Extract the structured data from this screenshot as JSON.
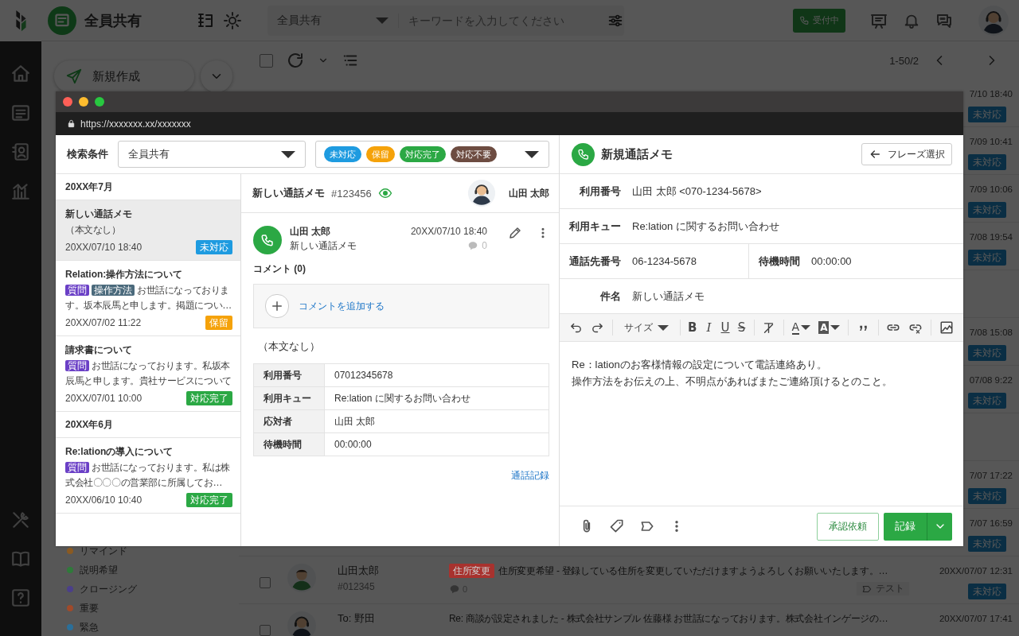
{
  "app": {
    "header": {
      "workspace": "全員共有",
      "search_scope": "全員共有",
      "search_placeholder": "キーワードを入力してください",
      "status_button": "受付中"
    },
    "compose_button": "新規作成",
    "select_all_checked": false,
    "pagination": "1-50/2",
    "labels": [
      {
        "name": "リマインド",
        "color": "#8a5a22"
      },
      {
        "name": "説明希望",
        "color": "#2f7a3a"
      },
      {
        "name": "クロージング",
        "color": "#4b3f8a"
      },
      {
        "name": "重要",
        "color": "#a04a2a"
      },
      {
        "name": "緊急",
        "color": "#2a6f9a"
      }
    ],
    "rows": [
      {
        "kind": "covered",
        "time": "7/10 18:40",
        "status": "未対応"
      },
      {
        "kind": "covered",
        "time": "7/09 10:41",
        "status": "未対応"
      },
      {
        "kind": "covered",
        "time": "7/09 10:06",
        "status": "未対応"
      },
      {
        "kind": "covered",
        "time": "7/08 19:54",
        "status": "未対応"
      },
      {
        "kind": "blank"
      },
      {
        "kind": "covered",
        "time": "7/08 15:08",
        "status": "未対応"
      },
      {
        "kind": "covered",
        "time": "07/08 9:22",
        "status": "未対応"
      },
      {
        "kind": "blank"
      },
      {
        "kind": "covered",
        "time": "7/07 17:22",
        "status": "未対応"
      },
      {
        "kind": "covered",
        "time": "7/07 16:59",
        "status": "未対応"
      },
      {
        "kind": "full",
        "checked": false,
        "avatar": {
          "kind": "person"
        },
        "name": "山田太郎",
        "id": "#012345",
        "tag": {
          "label": "住所変更",
          "color": "#a8322e"
        },
        "subject": "住所変更希望 - 登録している住所を変更していただけますようよろしくお願いいたします。…",
        "comments": "0",
        "label": "テスト",
        "time": "20XX/07/07 12:31",
        "status": "未対応"
      },
      {
        "kind": "full",
        "checked": false,
        "avatar": {
          "kind": "headset"
        },
        "name": "To: 野田",
        "subject": "Re: 商談が設定されました - 株式会社サンプル 佐藤様 お世話になっております。株式会社インゲージの…",
        "time": "20XX/07/07 17:41"
      }
    ]
  },
  "popup": {
    "url": "https://xxxxxxx.xx/xxxxxxx",
    "filter": {
      "label": "検索条件",
      "scope": "全員共有",
      "statuses": [
        {
          "label": "未対応",
          "color": "#1e9be0"
        },
        {
          "label": "保留",
          "color": "#f5a20a"
        },
        {
          "label": "対応完了",
          "color": "#2ba844"
        },
        {
          "label": "対応不要",
          "color": "#6d4c41"
        }
      ]
    },
    "threads": [
      {
        "kind": "section",
        "label": "20XX年7月"
      },
      {
        "kind": "item",
        "title": "新しい通話メモ",
        "preview": "（本文なし）",
        "date": "20XX/07/10 18:40",
        "status": {
          "label": "未対応",
          "color": "#1e9be0"
        },
        "selected": true
      },
      {
        "kind": "item",
        "title": "Relation:操作方法について",
        "tags": [
          {
            "label": "質問",
            "color": "#6a3fc6"
          },
          {
            "label": "操作方法",
            "color": "#4b6a7c"
          }
        ],
        "preview": "お世話になっております。坂本辰馬と申します。掲題につい…",
        "date": "20XX/07/02 11:22",
        "status": {
          "label": "保留",
          "color": "#f5a20a"
        },
        "selected": false
      },
      {
        "kind": "item",
        "title": "請求書について",
        "tags": [
          {
            "label": "質問",
            "color": "#6a3fc6"
          }
        ],
        "preview": "お世話になっております。私坂本辰馬と申します。貴社サービスについて",
        "date": "20XX/07/01 10:00",
        "status": {
          "label": "対応完了",
          "color": "#2ba844"
        },
        "selected": false
      },
      {
        "kind": "section",
        "label": "20XX年6月"
      },
      {
        "kind": "item",
        "title": "Re:lationの導入について",
        "tags": [
          {
            "label": "質問",
            "color": "#6a3fc6"
          }
        ],
        "preview": "お世話になっております。私は株式会社〇〇〇の営業部に所属してお…",
        "date": "20XX/06/10 10:40",
        "status": {
          "label": "対応完了",
          "color": "#2ba844"
        },
        "selected": false
      }
    ],
    "detail": {
      "title": "新しい通話メモ",
      "number": "#123456",
      "assignee": "山田 太郎",
      "message": {
        "sender": "山田 太郎",
        "subject": "新しい通話メモ",
        "date": "20XX/07/10 18:40",
        "comment_count": "0"
      },
      "comments_heading": "コメント (0)",
      "add_comment": "コメントを追加する",
      "body": "（本文なし）",
      "call_info": [
        {
          "label": "利用番号",
          "value": "07012345678"
        },
        {
          "label": "利用キュー",
          "value": "Re:lation に関するお問い合わせ"
        },
        {
          "label": "応対者",
          "value": "山田 太郎"
        },
        {
          "label": "待機時間",
          "value": "00:00:00"
        }
      ],
      "call_log_link": "通話記録"
    },
    "compose": {
      "title": "新規通話メモ",
      "phrase_button": "フレーズ選択",
      "fields": [
        [
          {
            "label": "利用番号",
            "value": "山田 太郎 <070-1234-5678>"
          }
        ],
        [
          {
            "label": "利用キュー",
            "value": "Re:lation に関するお問い合わせ"
          }
        ],
        [
          {
            "label": "通話先番号",
            "value": "06-1234-5678"
          },
          {
            "label": "待機時間",
            "value": "00:00:00"
          }
        ],
        [
          {
            "label": "件名",
            "value": "新しい通話メモ"
          }
        ]
      ],
      "toolbar": {
        "size_menu": "サイズ",
        "format_buttons": [
          {
            "kind": "bold",
            "glyph": "B"
          },
          {
            "kind": "italic",
            "glyph": "I"
          },
          {
            "kind": "underline",
            "glyph": "U"
          },
          {
            "kind": "strike",
            "glyph": "S"
          }
        ],
        "color_buttons": [
          {
            "kind": "text-color",
            "glyph": "A"
          },
          {
            "kind": "highlight",
            "glyph": "A"
          }
        ]
      },
      "body_lines": [
        "Re：lationのお客様情報の設定について電話連絡あり。",
        "操作方法をお伝えの上、不明点があればまたご連絡頂けるとのこと。"
      ],
      "approval_button": "承認依頼",
      "record_button": "記録"
    }
  }
}
